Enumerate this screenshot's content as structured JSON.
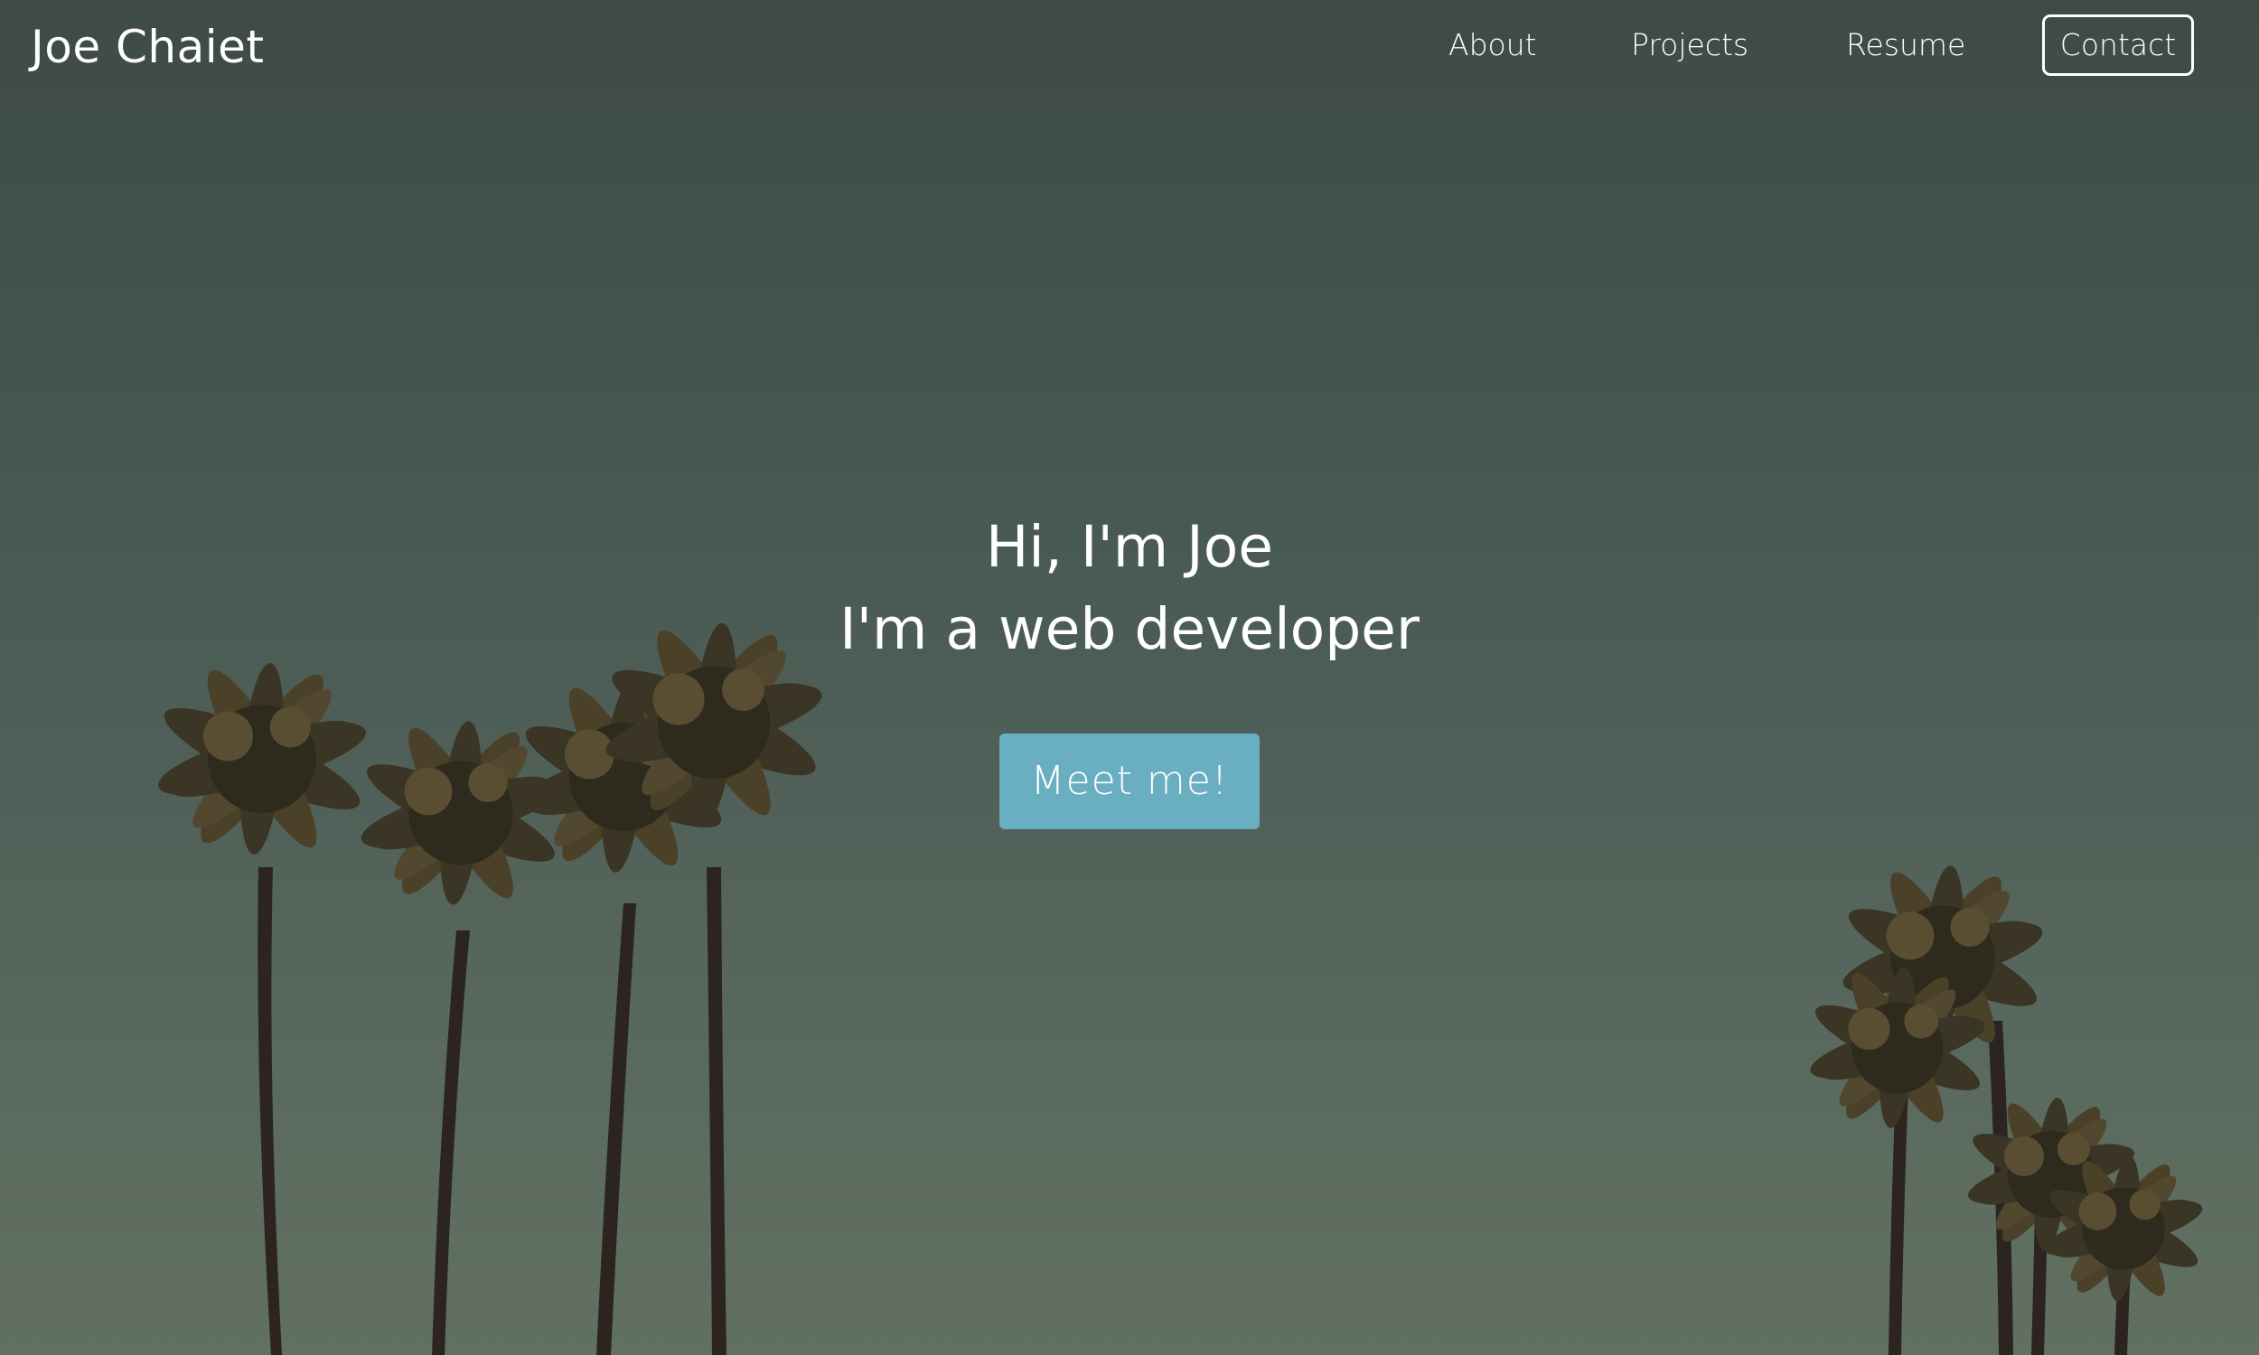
{
  "header": {
    "brand": "Joe Chaiet",
    "nav": [
      {
        "label": "About"
      },
      {
        "label": "Projects"
      },
      {
        "label": "Resume"
      },
      {
        "label": "Contact"
      }
    ]
  },
  "hero": {
    "line1": "Hi, I'm Joe",
    "line2": "I'm a web developer",
    "button_label": "Meet me!"
  },
  "colors": {
    "cta_background": "#6aaec1",
    "text": "#ffffff",
    "sky_top": "#3e4a46",
    "sky_bottom": "#61705f"
  }
}
